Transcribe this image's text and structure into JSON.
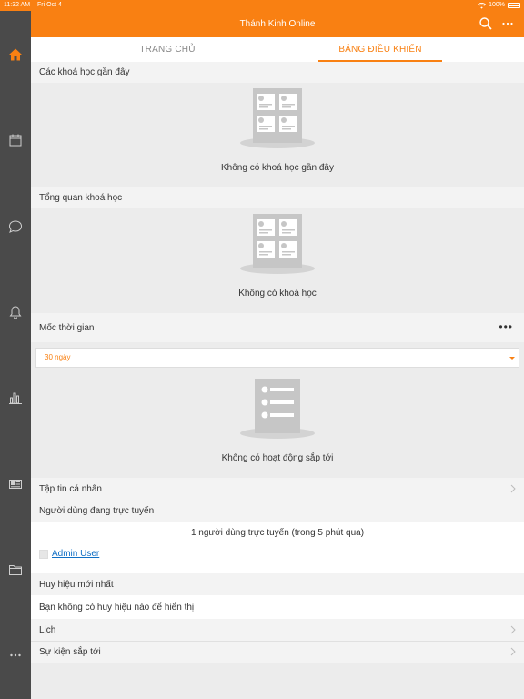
{
  "status_bar": {
    "time": "11:32 AM",
    "date": "Fri Oct 4",
    "battery": "100%"
  },
  "sidebar": {
    "items": [
      {
        "icon": "home-icon"
      },
      {
        "icon": "calendar-icon"
      },
      {
        "icon": "chat-icon"
      },
      {
        "icon": "bell-icon"
      },
      {
        "icon": "chart-icon"
      },
      {
        "icon": "news-icon"
      },
      {
        "icon": "folder-icon"
      },
      {
        "icon": "more-icon"
      }
    ]
  },
  "header": {
    "title": "Thánh Kinh Online"
  },
  "tabs": [
    {
      "label": "TRANG CHỦ"
    },
    {
      "label": "BẢNG ĐIỀU KHIỂN"
    }
  ],
  "recent_courses": {
    "heading": "Các khoá học gần đây",
    "empty": "Không có khoá học gần đây"
  },
  "course_overview": {
    "heading": "Tổng quan khoá học",
    "empty": "Không có khoá học"
  },
  "timeline": {
    "heading": "Mốc thời gian",
    "filter_value": "30 ngày",
    "empty": "Không có hoạt động sắp tới"
  },
  "private_files": {
    "label": "Tập tin cá nhân"
  },
  "online_users": {
    "heading": "Người dùng đang trực tuyến",
    "summary": "1 người dùng trực tuyến (trong 5 phút qua)",
    "user": "Admin User"
  },
  "badges": {
    "heading": "Huy hiệu mới nhất",
    "empty": "Bạn không có huy hiệu nào để hiển thị"
  },
  "calendar": {
    "label": "Lịch"
  },
  "upcoming_events": {
    "label": "Sự kiện sắp tới"
  },
  "colors": {
    "accent": "#f98012",
    "sidebar": "#4a4a4a",
    "background": "#ececec",
    "link": "#0f6fc5"
  }
}
